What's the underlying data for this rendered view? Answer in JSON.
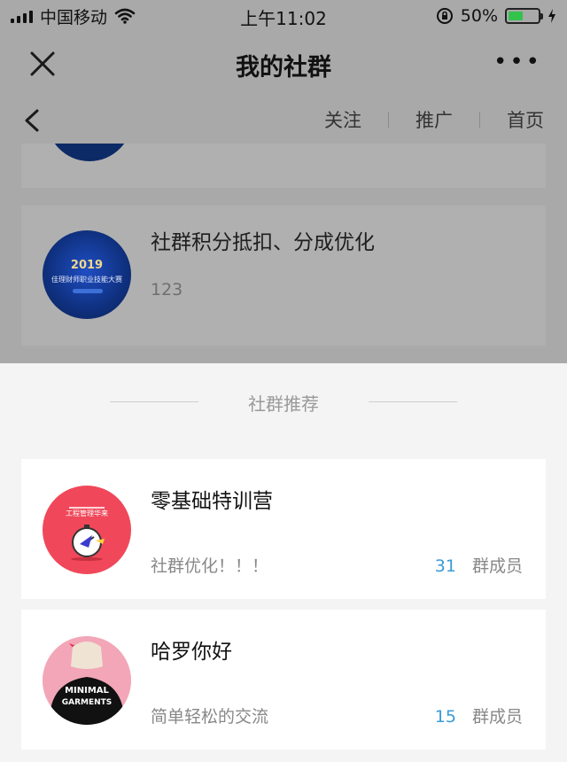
{
  "status_bar": {
    "carrier": "中国移动",
    "time": "上午11:02",
    "battery_percent": "50%",
    "battery_level": 0.5
  },
  "nav": {
    "title": "我的社群",
    "more": "•••",
    "close_icon": "close-icon",
    "more_icon": "more-icon"
  },
  "sub_nav": {
    "links": [
      "关注",
      "推广",
      "首页"
    ]
  },
  "my_groups": [
    {
      "title": "社群积分抵扣、分成优化",
      "description": "123",
      "avatar_text": {
        "year": "2019",
        "subtitle": "佳理财师职业技能大赛"
      }
    }
  ],
  "recommend": {
    "section_title": "社群推荐",
    "items": [
      {
        "title": "零基础特训营",
        "description": "社群优化！！！",
        "member_count": "31",
        "member_label": "群成员",
        "avatar_text": "工程管理华来"
      },
      {
        "title": "哈罗你好",
        "description": "简单轻松的交流",
        "member_count": "15",
        "member_label": "群成员",
        "avatar_text": {
          "line1": "MINIMAL",
          "line2": "GARMENTS"
        }
      }
    ]
  },
  "colors": {
    "overlay": "#a9a9a9",
    "member_count": "#3a9bd9",
    "battery": "#33c24d",
    "avatar_red": "#f0485a"
  }
}
